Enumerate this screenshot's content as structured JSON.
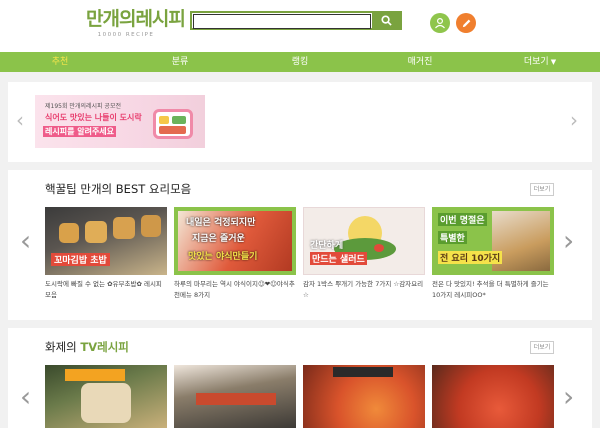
{
  "header": {
    "logo_main": "만개의레시피",
    "logo_sub": "10000 RECIPE",
    "search_value": ""
  },
  "nav": {
    "items": [
      {
        "label": "추천",
        "active": true
      },
      {
        "label": "분류",
        "active": false
      },
      {
        "label": "랭킹",
        "active": false
      },
      {
        "label": "매거진",
        "active": false
      },
      {
        "label": "더보기",
        "active": false
      }
    ]
  },
  "banner": {
    "small_text": "제195회 만개의레시피 공모전",
    "line1": "식어도 맛있는 나들이 도시락",
    "line2": "레시피를 알려주세요"
  },
  "best": {
    "title_main": "핵꿀팁 만개의 BEST 요리모음",
    "more": "더보기",
    "cards": [
      {
        "thumb_text": "꼬마김밥 초밥",
        "caption": "도시락에 빠질 수 없는 ✿유부초밥✿ 레시피 모음"
      },
      {
        "thumb_line1": "내일은 걱정되지만",
        "thumb_line2": "지금은 즐거운",
        "thumb_line3": "맛있는 야식만들기",
        "caption": "하루의 마무리는 역시 야식이지☺❤☺야식추천메뉴 8가지"
      },
      {
        "thumb_line1": "간단하게",
        "thumb_line2": "만드는 샐러드",
        "caption": "감자 1박스 뿌개기 가능한 7가지 ☆감자요리☆"
      },
      {
        "thumb_line1": "이번 명절은",
        "thumb_line2": "특별한",
        "thumb_line3": "전 요리 10가지",
        "caption": "전은 다 맛있지! 추석을 더 특별하게 즐기는 10가지 레시피OO*"
      }
    ]
  },
  "tv": {
    "title_a": "화제의 ",
    "title_b": "TV레시피",
    "more": "더보기"
  },
  "colors": {
    "brand_green": "#7aa33f",
    "nav_green": "#8bc34a",
    "nav_active": "#f7e64a",
    "write_orange": "#f07f2e"
  },
  "icons": [
    "search-icon",
    "user-icon",
    "pencil-icon",
    "chevron-left-icon",
    "chevron-right-icon",
    "chevron-down-icon"
  ]
}
